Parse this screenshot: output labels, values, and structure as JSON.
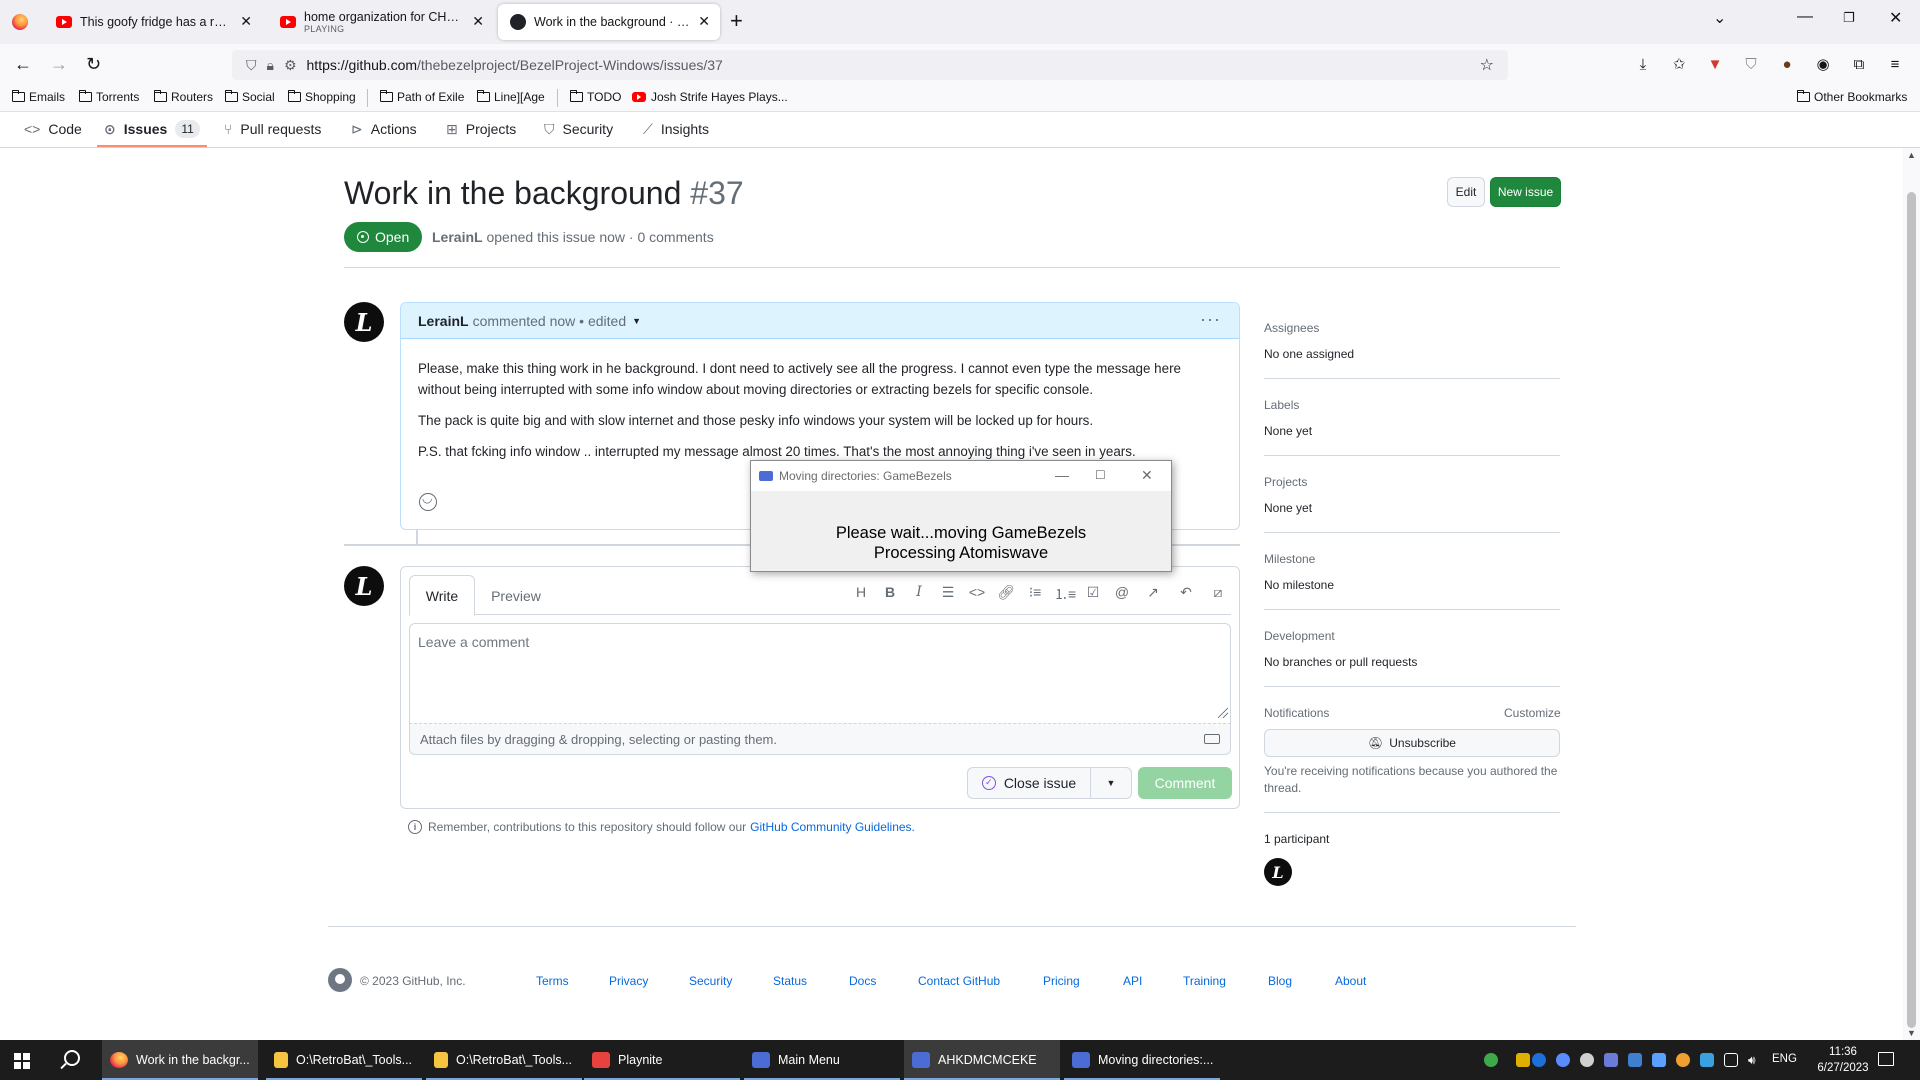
{
  "browser": {
    "tabs": [
      {
        "title": "This goofy fridge has a really cle",
        "sub": ""
      },
      {
        "title": "home organization for CHAOTIC",
        "sub": "PLAYING"
      },
      {
        "title": "Work in the background · Issue",
        "sub": ""
      }
    ],
    "url_host": "https://github.com",
    "url_path": "/thebezelproject/BezelProject-Windows/issues/37",
    "bookmarks": [
      "Emails",
      "Torrents",
      "Routers",
      "Social",
      "Shopping",
      "Path of Exile",
      "Line][Age",
      "TODO",
      "Josh Strife Hayes Plays...",
      "Other Bookmarks"
    ]
  },
  "repo_nav": {
    "code": "Code",
    "issues": "Issues",
    "issues_count": "11",
    "pulls": "Pull requests",
    "actions": "Actions",
    "projects": "Projects",
    "security": "Security",
    "insights": "Insights"
  },
  "issue": {
    "title": "Work in the background",
    "number": "#37",
    "edit_label": "Edit",
    "new_issue_label": "New issue",
    "state": "Open",
    "author": "LerainL",
    "meta_rest": "opened this issue now · 0 comments",
    "avatar_letter": "L"
  },
  "comment": {
    "author": "LerainL",
    "head_rest": "commented now • edited",
    "kebab": "···",
    "paragraphs": [
      "Please, make this thing work in he background. I dont need to actively see all the progress. I cannot even type the message here without being interrupted with some info window about moving directories or extracting bezels for specific console.",
      "The pack is quite big and with slow internet and those pesky info windows your system will be locked up for hours.",
      "P.S. that fcking info window .. interrupted my message almost 20 times. That's the most annoying thing i've seen in years."
    ]
  },
  "editor": {
    "write_tab": "Write",
    "preview_tab": "Preview",
    "placeholder": "Leave a comment",
    "attach_text": "Attach files by dragging & dropping, selecting or pasting them.",
    "close_issue": "Close issue",
    "comment_btn": "Comment"
  },
  "notice": {
    "text": "Remember, contributions to this repository should follow our",
    "link": "GitHub Community Guidelines."
  },
  "sidebar": {
    "assignees_label": "Assignees",
    "assignees_value": "No one assigned",
    "labels_label": "Labels",
    "labels_value": "None yet",
    "projects_label": "Projects",
    "projects_value": "None yet",
    "milestone_label": "Milestone",
    "milestone_value": "No milestone",
    "development_label": "Development",
    "development_value": "No branches or pull requests",
    "notifications_label": "Notifications",
    "customize": "Customize",
    "unsubscribe": "Unsubscribe",
    "notif_reason": "You're receiving notifications because you authored the thread.",
    "participants": "1 participant"
  },
  "footer": {
    "copyright": "© 2023 GitHub, Inc.",
    "links": [
      "Terms",
      "Privacy",
      "Security",
      "Status",
      "Docs",
      "Contact GitHub",
      "Pricing",
      "API",
      "Training",
      "Blog",
      "About"
    ]
  },
  "dialog": {
    "title": "Moving directories: GameBezels",
    "line1": "Please wait...moving GameBezels",
    "line2": "Processing Atomiswave"
  },
  "taskbar": {
    "apps": [
      "Work in the backgr...",
      "O:\\RetroBat\\_Tools...",
      "O:\\RetroBat\\_Tools...",
      "Playnite",
      "Main Menu",
      "AHKDMCMCEKE",
      "Moving directories:..."
    ],
    "lang": "ENG",
    "time": "11:36",
    "date": "6/27/2023"
  },
  "colors": {
    "accent_green": "#1f883d",
    "link_blue": "#0969da",
    "comment_header": "#ddf4ff"
  }
}
